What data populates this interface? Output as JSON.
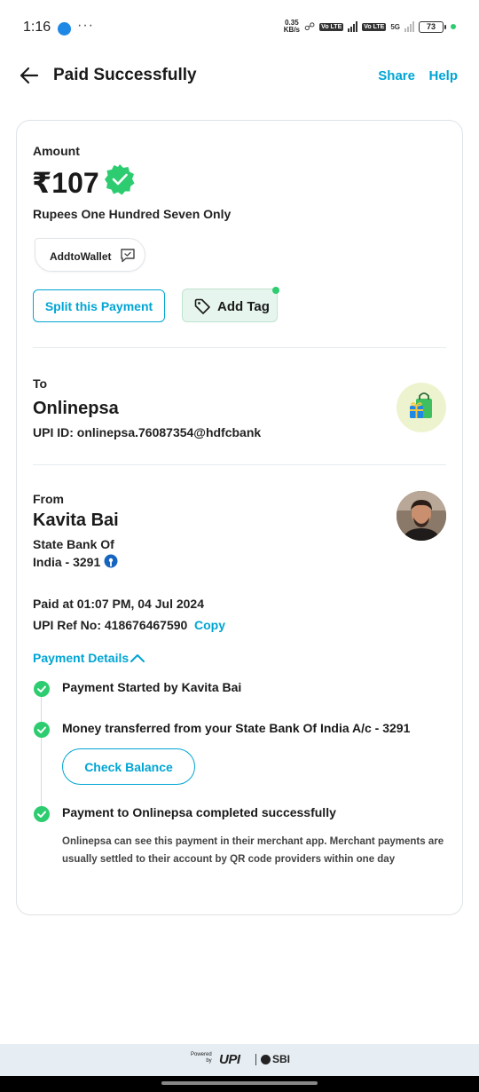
{
  "status_bar": {
    "time": "1:16",
    "dots": "···",
    "net_speed_value": "0.35",
    "net_speed_unit": "KB/s",
    "net_type": "5G",
    "volte_label": "Vo LTE",
    "battery": "73"
  },
  "header": {
    "title": "Paid Successfully",
    "share_label": "Share",
    "help_label": "Help"
  },
  "amount": {
    "label": "Amount",
    "value": "₹107",
    "in_words": "Rupees One Hundred Seven Only"
  },
  "wallet_chip": {
    "label": "AddtoWallet"
  },
  "actions": {
    "split_label": "Split this Payment",
    "tag_label": "Add Tag"
  },
  "to": {
    "label": "To",
    "name": "Onlinepsa",
    "upi_id": "UPI ID: onlinepsa.76087354@hdfcbank"
  },
  "from": {
    "label": "From",
    "name": "Kavita Bai",
    "bank_line1": "State Bank Of",
    "bank_line2": "India - 3291"
  },
  "transaction": {
    "paid_at": "Paid at 01:07 PM, 04 Jul 2024",
    "upi_ref": "UPI Ref No: 418676467590",
    "copy_label": "Copy"
  },
  "payment_details": {
    "toggle_label": "Payment Details",
    "steps": [
      {
        "text": "Payment Started by Kavita Bai"
      },
      {
        "text": "Money transferred from your State Bank Of India A/c - 3291"
      },
      {
        "text": "Payment to Onlinepsa completed successfully"
      }
    ],
    "check_balance_label": "Check Balance",
    "completion_note": "Onlinepsa can see this payment in their merchant app. Merchant payments are usually settled to their account by QR code providers within one day"
  },
  "footer": {
    "powered_line1": "Powered",
    "powered_line2": "by",
    "upi_logo": "UPI",
    "partner": "SBI"
  },
  "colors": {
    "accent": "#00a5d4",
    "success": "#2ecc71",
    "tag_bg": "#e6f6ee",
    "card_border": "#dde3e8",
    "footer_bg": "#e6eef3"
  },
  "icons": {
    "back": "arrow-left-icon",
    "verified": "verified-badge-icon",
    "wallet": "chat-bubble-icon",
    "tag": "tag-icon",
    "merchant": "shopping-bag-icon",
    "bank": "sbi-bank-icon",
    "expand": "chevron-up-icon",
    "step": "check-circle-icon"
  }
}
